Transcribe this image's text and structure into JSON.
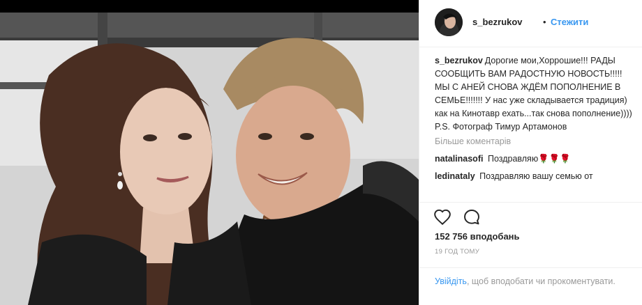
{
  "post": {
    "username": "s_bezrukov",
    "separator": "•",
    "follow_label": "Стежити",
    "caption_username": "s_bezrukov",
    "caption_text": "Дорогие мои,Хоррошие!!! РАДЫ СООБЩИТЬ ВАМ РАДОСТНУЮ НОВОСТЬ!!!!! МЫ С АНЕЙ СНОВА ЖДЁМ ПОПОЛНЕНИЕ В СЕМЬЕ!!!!!!! У нас уже складывается традиция) как на Кинотавр ехать...так снова пополнение)))) P.S. Фотограф Тимур Артамонов",
    "more_comments": "Більше коментарів",
    "comments": [
      {
        "username": "natalinasofi",
        "text": "Поздравляю🌹🌹🌹"
      },
      {
        "username": "ledinataly",
        "text": "Поздравляю вашу семью от"
      }
    ],
    "likes": "152 756 вподобань",
    "timestamp": "19 год тому",
    "login_link": "Увійдіть",
    "login_rest": ", щоб вподобати чи прокоментувати."
  },
  "icons": {
    "like": "heart-icon",
    "comment": "comment-bubble-icon"
  }
}
